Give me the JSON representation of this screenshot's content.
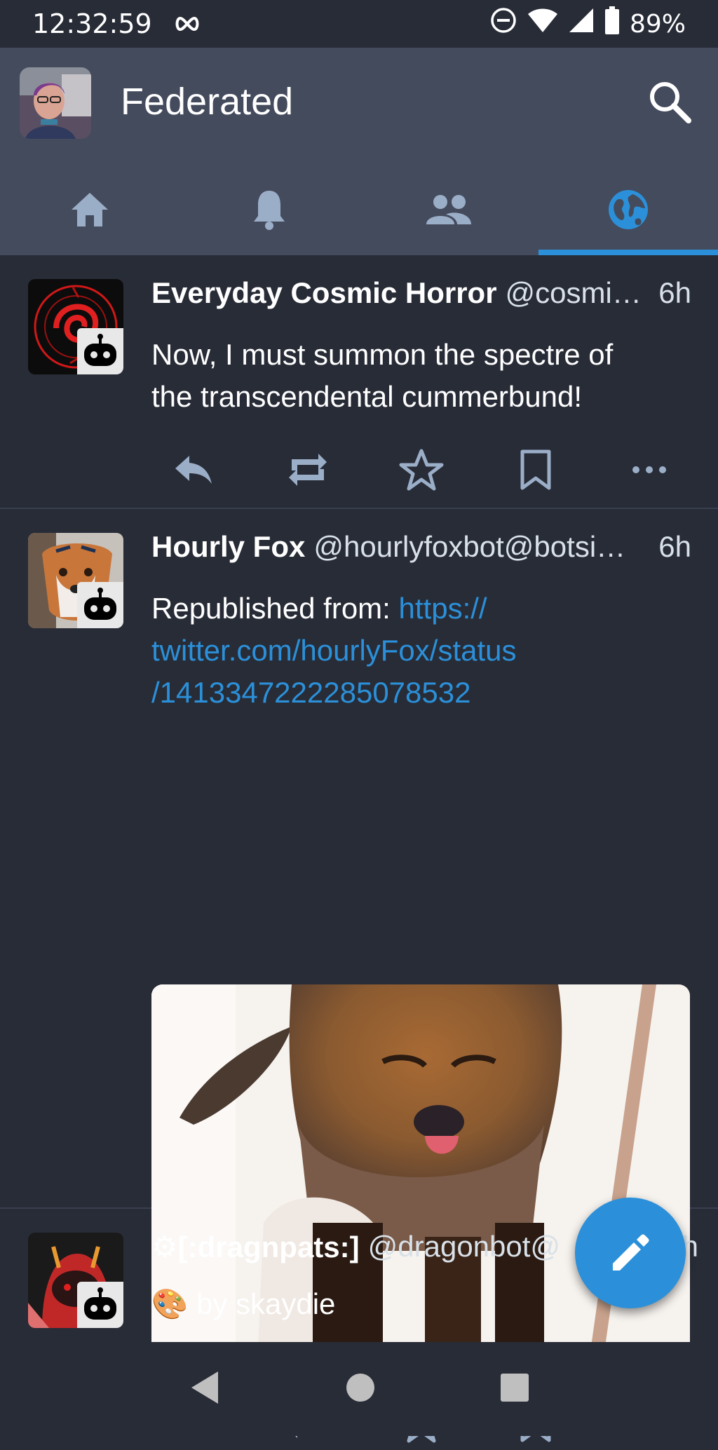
{
  "status_bar": {
    "time": "12:32:59",
    "infinity_icon": "infinity-icon",
    "battery": "89%"
  },
  "app_bar": {
    "title": "Federated"
  },
  "tabs": [
    {
      "name": "home",
      "icon": "home-icon",
      "active": false
    },
    {
      "name": "notifications",
      "icon": "bell-icon",
      "active": false
    },
    {
      "name": "local",
      "icon": "people-icon",
      "active": false
    },
    {
      "name": "federated",
      "icon": "globe-icon",
      "active": true
    }
  ],
  "statuses": [
    {
      "display_name": "Everyday Cosmic Horror",
      "acct": "@cosmi…",
      "time": "6h",
      "content_line1": "Now, I must summon the spectre of",
      "content_line2": "the transcendental cummerbund!"
    },
    {
      "display_name": "Hourly Fox",
      "acct": "@hourlyfoxbot@botsi…",
      "time": "6h",
      "content_prefix": "Republished from: ",
      "link_line1": "https://",
      "link_line2": "twitter.com/hourlyFox/status",
      "link_line3": "/1413347222285078532"
    },
    {
      "display_name": "⚙[:dragnpats:]",
      "acct": "@dragonbot@",
      "time": "h",
      "content_emoji": "🎨",
      "content_text": " by skaydie"
    }
  ],
  "colors": {
    "background": "#282c37",
    "bar": "#444b5d",
    "accent": "#2b90d9",
    "icon": "#9baec8"
  }
}
